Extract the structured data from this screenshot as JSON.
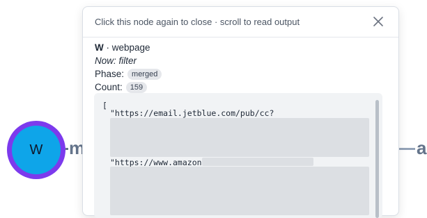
{
  "graph": {
    "node_letter": "W",
    "edge_left_label": "me",
    "edge_right_label": "a."
  },
  "popup": {
    "hint": "Click this node again to close · scroll to read output",
    "node_id": "W",
    "node_type": "webpage",
    "separator": " · ",
    "now_text": "Now: filter",
    "phase_label": "Phase:",
    "phase_value": "merged",
    "count_label": "Count:",
    "count_value": "159",
    "output": {
      "open_bracket": "[",
      "url1": "\"https://email.jetblue.com/pub/cc?",
      "url2": "\"https://www.amazon.com"
    }
  },
  "colors": {
    "node_fill": "#0ea5e9",
    "node_ring": "#7c3aed",
    "edge": "#64748b"
  },
  "icons": {
    "close": "close-icon"
  }
}
